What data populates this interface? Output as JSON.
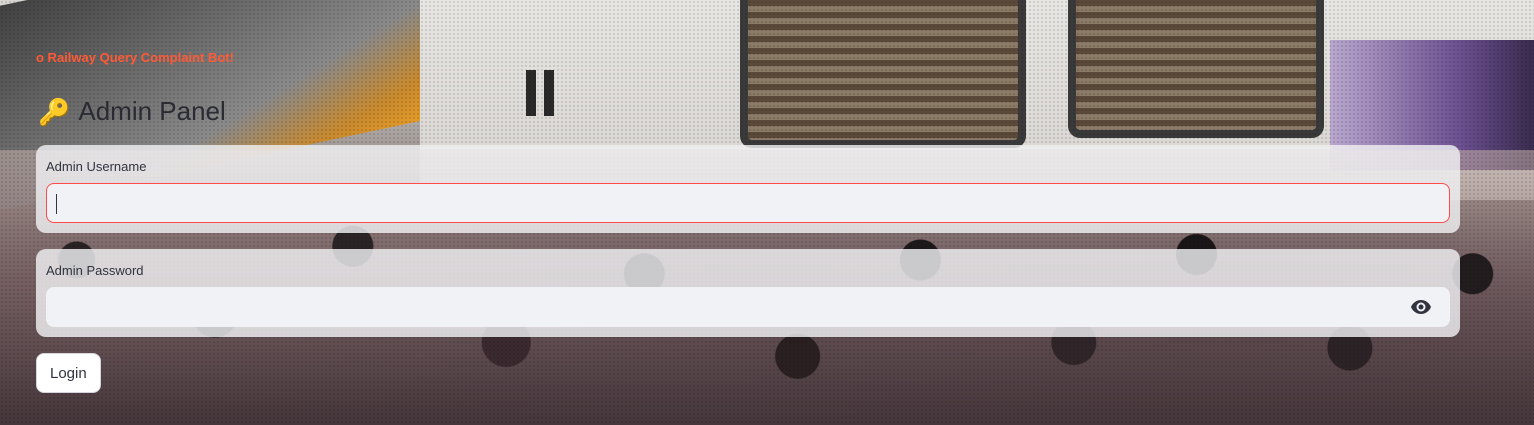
{
  "app": {
    "bot_title": "o Railway Query Complaint Bot!",
    "panel_icon": "key-icon",
    "panel_title": "Admin Panel"
  },
  "form": {
    "username": {
      "label": "Admin Username",
      "value": "",
      "placeholder": ""
    },
    "password": {
      "label": "Admin Password",
      "value": "",
      "placeholder": "",
      "toggle_icon": "eye-icon"
    },
    "login_label": "Login"
  },
  "colors": {
    "accent": "#ff4b4b",
    "bot_title": "#ff5a36",
    "text": "#31333f",
    "input_bg": "#f0f2f6"
  }
}
